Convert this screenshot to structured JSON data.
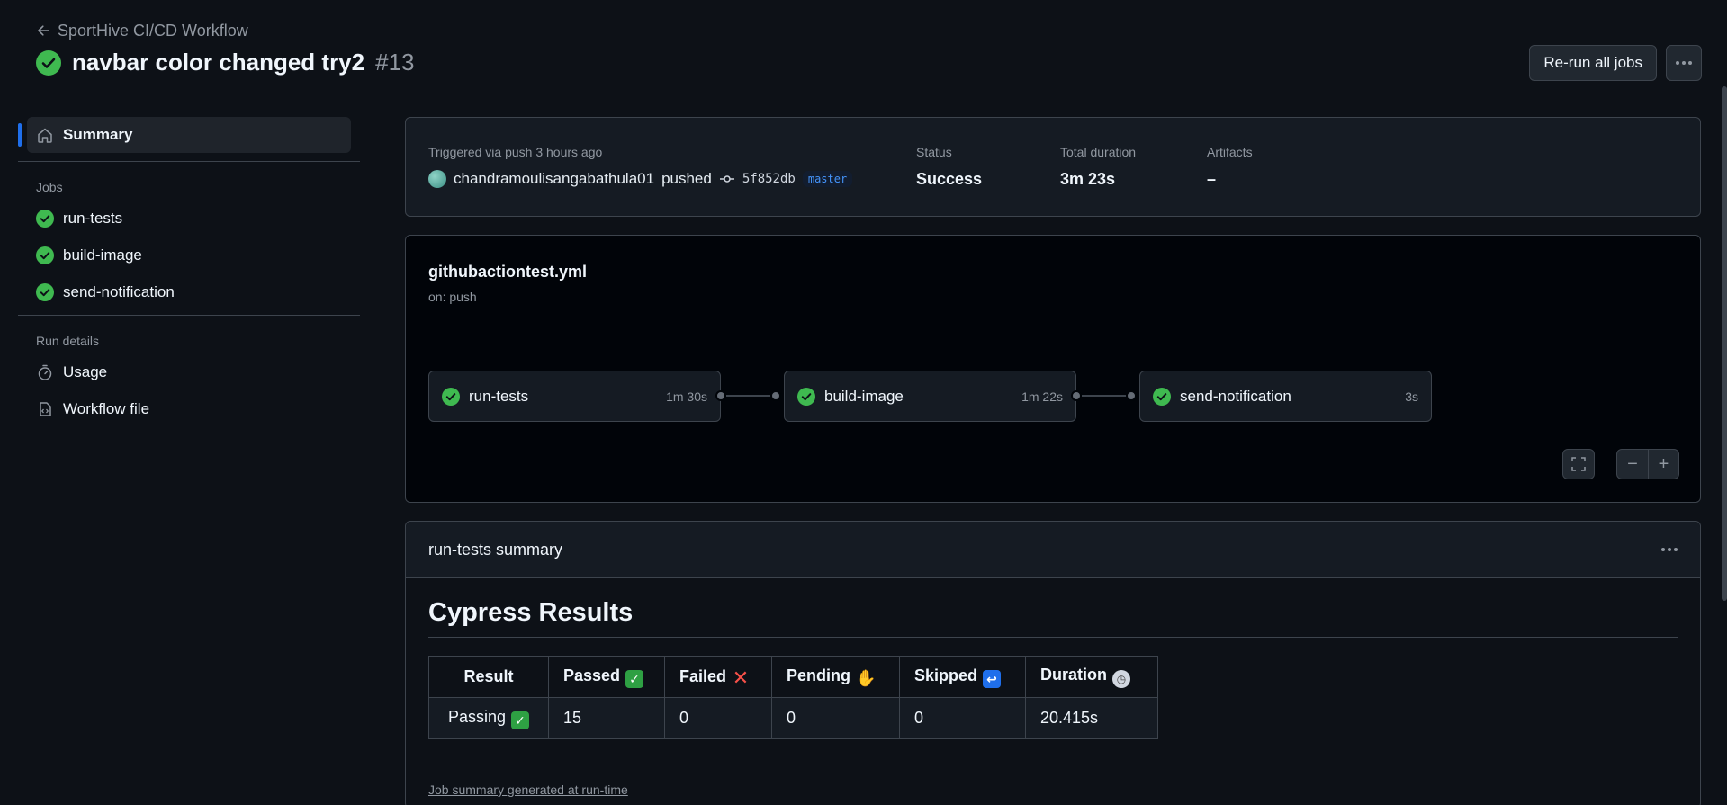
{
  "header": {
    "back_label": "SportHive CI/CD Workflow",
    "title": "navbar color changed try2",
    "run_number": "#13",
    "rerun_label": "Re-run all jobs"
  },
  "sidebar": {
    "summary_label": "Summary",
    "jobs_heading": "Jobs",
    "jobs": [
      {
        "label": "run-tests"
      },
      {
        "label": "build-image"
      },
      {
        "label": "send-notification"
      }
    ],
    "run_details_heading": "Run details",
    "details": [
      {
        "label": "Usage",
        "icon": "stopwatch-icon"
      },
      {
        "label": "Workflow file",
        "icon": "file-code-icon"
      }
    ]
  },
  "summary": {
    "trigger_text": "Triggered via push 3 hours ago",
    "actor": "chandramoulisangabathula01",
    "action": "pushed",
    "commit_sha": "5f852db",
    "branch": "master",
    "status_label": "Status",
    "status_value": "Success",
    "duration_label": "Total duration",
    "duration_value": "3m 23s",
    "artifacts_label": "Artifacts",
    "artifacts_value": "–"
  },
  "graph": {
    "workflow_file": "githubactiontest.yml",
    "trigger": "on: push",
    "jobs": [
      {
        "name": "run-tests",
        "duration": "1m 30s"
      },
      {
        "name": "build-image",
        "duration": "1m 22s"
      },
      {
        "name": "send-notification",
        "duration": "3s"
      }
    ]
  },
  "job_summary": {
    "title": "run-tests summary",
    "heading": "Cypress Results",
    "columns": [
      "Result",
      "Passed",
      "Failed",
      "Pending",
      "Skipped",
      "Duration"
    ],
    "row": [
      "Passing",
      "15",
      "0",
      "0",
      "0",
      "20.415s"
    ],
    "footer": "Job summary generated at run-time"
  },
  "colors": {
    "success": "#3fb950",
    "accent": "#1f6feb",
    "background": "#0d1117"
  }
}
